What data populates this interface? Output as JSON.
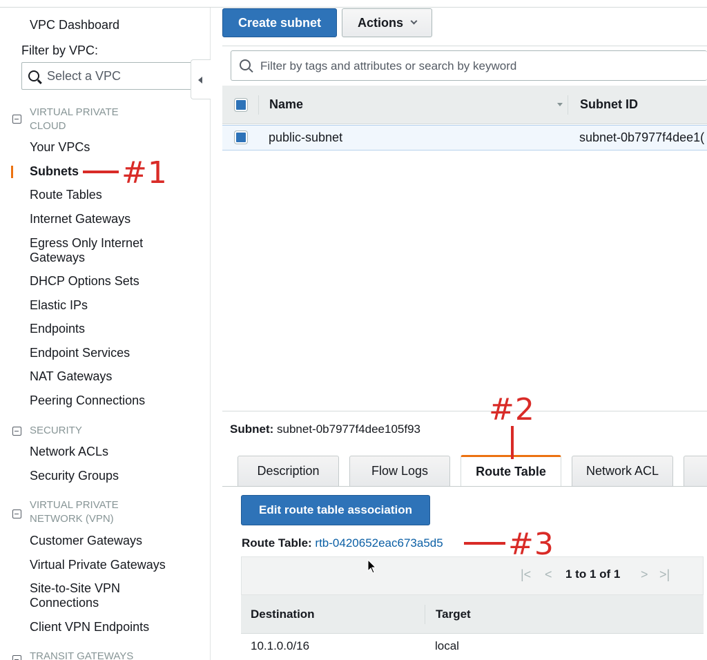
{
  "sidebar": {
    "dashboard": "VPC Dashboard",
    "filter_label": "Filter by VPC:",
    "vpc_select_placeholder": "Select a VPC",
    "sections": [
      {
        "title_line1": "VIRTUAL PRIVATE",
        "title_line2": "CLOUD"
      },
      {
        "title_line1": "SECURITY",
        "title_line2": ""
      },
      {
        "title_line1": "VIRTUAL PRIVATE",
        "title_line2": "NETWORK (VPN)"
      },
      {
        "title_line1": "TRANSIT GATEWAYS",
        "title_line2": ""
      }
    ],
    "vpc_items": [
      "Your VPCs",
      "Subnets",
      "Route Tables",
      "Internet Gateways",
      "Egress Only Internet",
      "Gateways",
      "DHCP Options Sets",
      "Elastic IPs",
      "Endpoints",
      "Endpoint Services",
      "NAT Gateways",
      "Peering Connections"
    ],
    "security_items": [
      "Network ACLs",
      "Security Groups"
    ],
    "vpn_items": [
      "Customer Gateways",
      "Virtual Private Gateways",
      "Site-to-Site VPN",
      "Connections",
      "Client VPN Endpoints"
    ],
    "active_item": "Subnets"
  },
  "toolbar": {
    "create_label": "Create subnet",
    "actions_label": "Actions"
  },
  "search": {
    "placeholder": "Filter by tags and attributes or search by keyword"
  },
  "subnets_table": {
    "columns": [
      "Name",
      "Subnet ID"
    ],
    "rows": [
      {
        "name": "public-subnet",
        "subnet_id": "subnet-0b7977f4dee1("
      }
    ]
  },
  "detail": {
    "subnet_label": "Subnet:",
    "subnet_value": "subnet-0b7977f4dee105f93",
    "tabs": [
      "Description",
      "Flow Logs",
      "Route Table",
      "Network ACL"
    ],
    "active_tab": "Route Table",
    "edit_button": "Edit route table association",
    "route_table_label": "Route Table:",
    "route_table_id": "rtb-0420652eac673a5d5",
    "pager_text": "1 to 1 of 1",
    "routes_columns": [
      "Destination",
      "Target"
    ],
    "routes": [
      {
        "destination": "10.1.0.0/16",
        "target": "local"
      }
    ]
  },
  "annotations": {
    "one": "#1",
    "two": "#2",
    "three": "#3"
  },
  "colors": {
    "primary": "#2e73b8",
    "active_accent": "#ec7211",
    "link": "#0b5fa5",
    "annotation": "#d92b27"
  }
}
